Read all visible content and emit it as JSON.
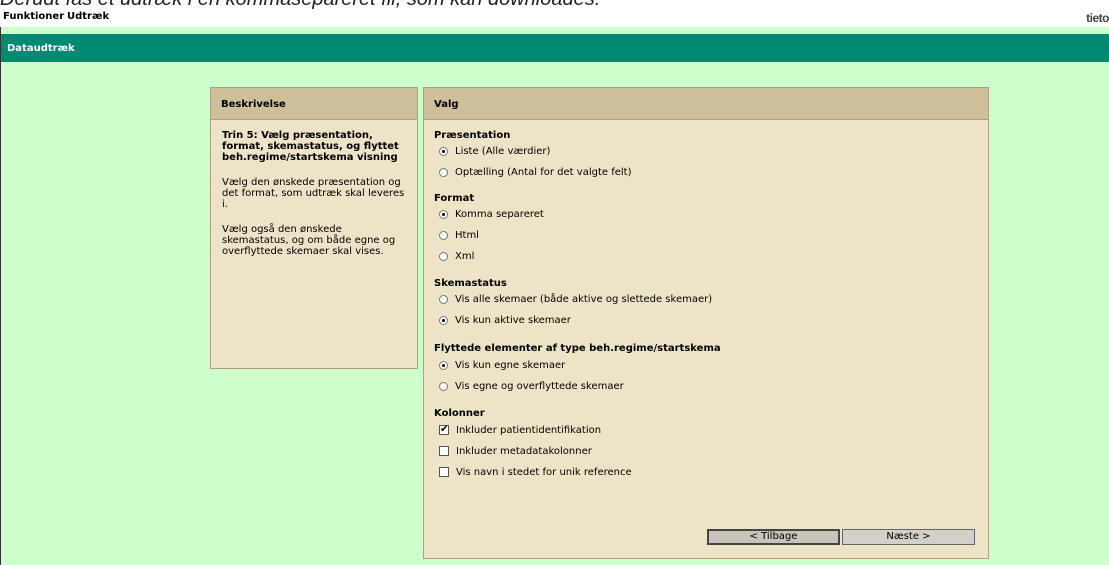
{
  "caption": "Derudt fås et udtræk i en kommasepareret fil, som kan downloades.",
  "menubar": {
    "items": [
      "Funktioner",
      "Udtræk"
    ],
    "logo": "tieto"
  },
  "header": {
    "title": "Dataudtræk"
  },
  "description": {
    "heading": "Beskrivelse",
    "step": "Trin 5: Vælg præsentation, format, skemastatus, og flyttet beh.regime/startskema visning",
    "paragraphs": [
      "Vælg den ønskede præsentation og det format, som udtræk skal leveres i.",
      "Vælg også den ønskede skemastatus, og om både egne og overflyttede skemaer skal vises."
    ]
  },
  "options": {
    "heading": "Valg",
    "presentation": {
      "title": "Præsentation",
      "options": [
        {
          "label": "Liste (Alle værdier)",
          "checked": true
        },
        {
          "label": "Optælling (Antal for det valgte felt)",
          "checked": false
        }
      ]
    },
    "format": {
      "title": "Format",
      "options": [
        {
          "label": "Komma separeret",
          "checked": true
        },
        {
          "label": "Html",
          "checked": false
        },
        {
          "label": "Xml",
          "checked": false
        }
      ]
    },
    "status": {
      "title": "Skemastatus",
      "options": [
        {
          "label": "Vis alle skemaer (både aktive og slettede skemaer)",
          "checked": false
        },
        {
          "label": "Vis kun aktive skemaer",
          "checked": true
        }
      ]
    },
    "moved": {
      "title": "Flyttede elementer af type beh.regime/startskema",
      "options": [
        {
          "label": "Vis kun egne skemaer",
          "checked": true
        },
        {
          "label": "Vis egne og overflyttede skemaer",
          "checked": false
        }
      ]
    },
    "columns": {
      "title": "Kolonner",
      "options": [
        {
          "label": "Inkluder patientidentifikation",
          "checked": true
        },
        {
          "label": "Inkluder metadatakolonner",
          "checked": false
        },
        {
          "label": "Vis navn i stedet for unik reference",
          "checked": false
        }
      ]
    },
    "buttons": {
      "back": "< Tilbage",
      "next": "Næste >"
    }
  },
  "colors": {
    "background": "#ccffcc",
    "header": "#008a72",
    "panel": "#ede3c6",
    "panel_head": "#ccbf99"
  }
}
